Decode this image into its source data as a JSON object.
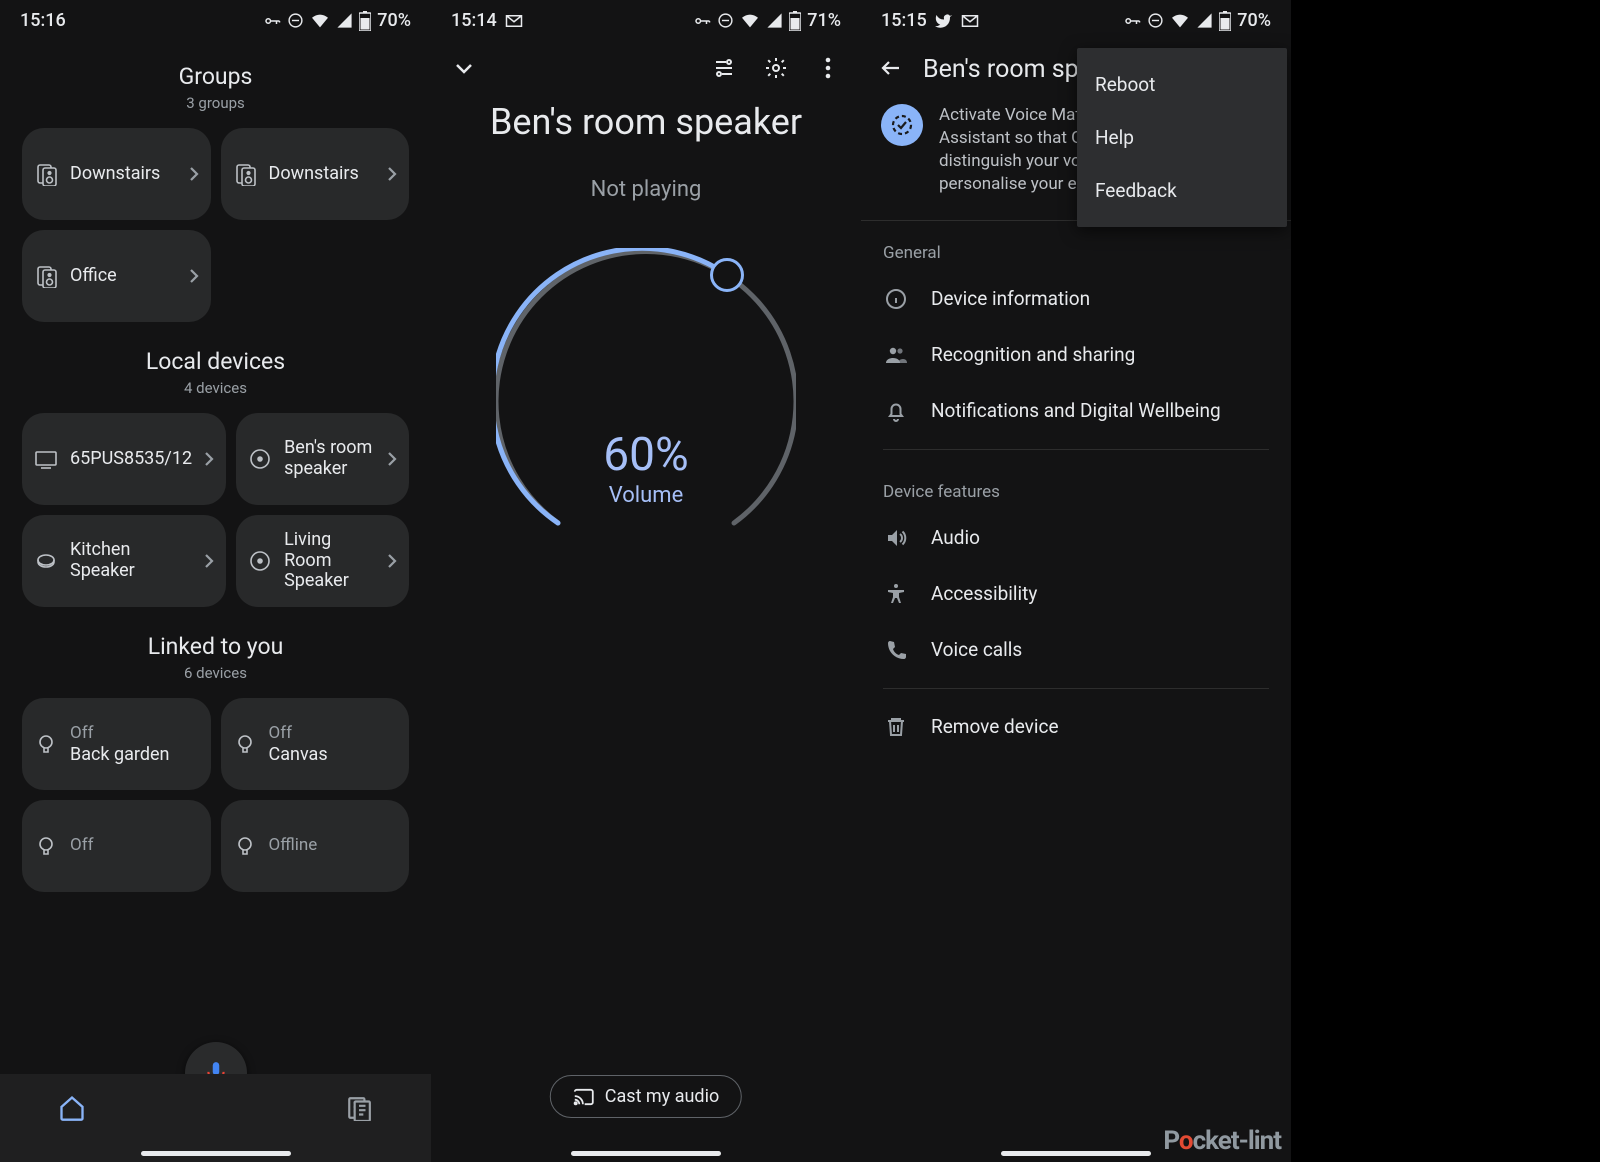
{
  "panes": {
    "home": {
      "status": {
        "time": "15:16",
        "battery": "70%"
      },
      "groups": {
        "title": "Groups",
        "count": "3 groups",
        "items": [
          {
            "label": "Downstairs"
          },
          {
            "label": "Downstairs"
          },
          {
            "label": "Office"
          }
        ]
      },
      "local": {
        "title": "Local devices",
        "count": "4 devices",
        "items": [
          {
            "label": "65PUS8535/12",
            "type": "tv"
          },
          {
            "label": "Ben's room speaker",
            "type": "speaker"
          },
          {
            "label": "Kitchen Speaker",
            "type": "speaker"
          },
          {
            "label": "Living Room Speaker",
            "type": "speaker"
          }
        ]
      },
      "linked": {
        "title": "Linked to you",
        "count": "6 devices",
        "items": [
          {
            "status": "Off",
            "label": "Back garden"
          },
          {
            "status": "Off",
            "label": "Canvas"
          },
          {
            "status": "Off",
            "label": ""
          },
          {
            "status": "Offline",
            "label": ""
          }
        ]
      }
    },
    "player": {
      "status": {
        "time": "15:14",
        "battery": "71%"
      },
      "title": "Ben's room speaker",
      "subtitle": "Not playing",
      "volume_value": "60%",
      "volume_label": "Volume",
      "cast": "Cast my audio"
    },
    "settings": {
      "status": {
        "time": "15:15",
        "battery": "70%"
      },
      "title": "Ben's room speak",
      "banner": "Activate Voice Match and set up the Assistant so that Google Assistant can distinguish your voice from others to personalise your experience",
      "general_label": "General",
      "general": [
        "Device information",
        "Recognition and sharing",
        "Notifications and Digital Wellbeing"
      ],
      "features_label": "Device features",
      "features": [
        "Audio",
        "Accessibility",
        "Voice calls"
      ],
      "remove": "Remove device",
      "menu": [
        "Reboot",
        "Help",
        "Feedback"
      ]
    }
  },
  "watermark": {
    "p1": "P",
    "p2": "o",
    "p3": "cket-lint"
  }
}
